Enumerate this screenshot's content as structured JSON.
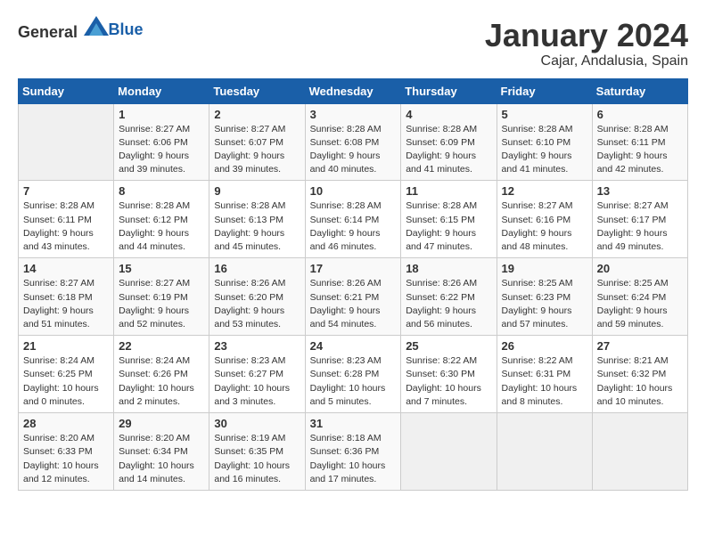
{
  "logo": {
    "general": "General",
    "blue": "Blue"
  },
  "header": {
    "title": "January 2024",
    "subtitle": "Cajar, Andalusia, Spain"
  },
  "columns": [
    "Sunday",
    "Monday",
    "Tuesday",
    "Wednesday",
    "Thursday",
    "Friday",
    "Saturday"
  ],
  "weeks": [
    [
      {
        "day": "",
        "sunrise": "",
        "sunset": "",
        "daylight": ""
      },
      {
        "day": "1",
        "sunrise": "Sunrise: 8:27 AM",
        "sunset": "Sunset: 6:06 PM",
        "daylight": "Daylight: 9 hours and 39 minutes."
      },
      {
        "day": "2",
        "sunrise": "Sunrise: 8:27 AM",
        "sunset": "Sunset: 6:07 PM",
        "daylight": "Daylight: 9 hours and 39 minutes."
      },
      {
        "day": "3",
        "sunrise": "Sunrise: 8:28 AM",
        "sunset": "Sunset: 6:08 PM",
        "daylight": "Daylight: 9 hours and 40 minutes."
      },
      {
        "day": "4",
        "sunrise": "Sunrise: 8:28 AM",
        "sunset": "Sunset: 6:09 PM",
        "daylight": "Daylight: 9 hours and 41 minutes."
      },
      {
        "day": "5",
        "sunrise": "Sunrise: 8:28 AM",
        "sunset": "Sunset: 6:10 PM",
        "daylight": "Daylight: 9 hours and 41 minutes."
      },
      {
        "day": "6",
        "sunrise": "Sunrise: 8:28 AM",
        "sunset": "Sunset: 6:11 PM",
        "daylight": "Daylight: 9 hours and 42 minutes."
      }
    ],
    [
      {
        "day": "7",
        "sunrise": "Sunrise: 8:28 AM",
        "sunset": "Sunset: 6:11 PM",
        "daylight": "Daylight: 9 hours and 43 minutes."
      },
      {
        "day": "8",
        "sunrise": "Sunrise: 8:28 AM",
        "sunset": "Sunset: 6:12 PM",
        "daylight": "Daylight: 9 hours and 44 minutes."
      },
      {
        "day": "9",
        "sunrise": "Sunrise: 8:28 AM",
        "sunset": "Sunset: 6:13 PM",
        "daylight": "Daylight: 9 hours and 45 minutes."
      },
      {
        "day": "10",
        "sunrise": "Sunrise: 8:28 AM",
        "sunset": "Sunset: 6:14 PM",
        "daylight": "Daylight: 9 hours and 46 minutes."
      },
      {
        "day": "11",
        "sunrise": "Sunrise: 8:28 AM",
        "sunset": "Sunset: 6:15 PM",
        "daylight": "Daylight: 9 hours and 47 minutes."
      },
      {
        "day": "12",
        "sunrise": "Sunrise: 8:27 AM",
        "sunset": "Sunset: 6:16 PM",
        "daylight": "Daylight: 9 hours and 48 minutes."
      },
      {
        "day": "13",
        "sunrise": "Sunrise: 8:27 AM",
        "sunset": "Sunset: 6:17 PM",
        "daylight": "Daylight: 9 hours and 49 minutes."
      }
    ],
    [
      {
        "day": "14",
        "sunrise": "Sunrise: 8:27 AM",
        "sunset": "Sunset: 6:18 PM",
        "daylight": "Daylight: 9 hours and 51 minutes."
      },
      {
        "day": "15",
        "sunrise": "Sunrise: 8:27 AM",
        "sunset": "Sunset: 6:19 PM",
        "daylight": "Daylight: 9 hours and 52 minutes."
      },
      {
        "day": "16",
        "sunrise": "Sunrise: 8:26 AM",
        "sunset": "Sunset: 6:20 PM",
        "daylight": "Daylight: 9 hours and 53 minutes."
      },
      {
        "day": "17",
        "sunrise": "Sunrise: 8:26 AM",
        "sunset": "Sunset: 6:21 PM",
        "daylight": "Daylight: 9 hours and 54 minutes."
      },
      {
        "day": "18",
        "sunrise": "Sunrise: 8:26 AM",
        "sunset": "Sunset: 6:22 PM",
        "daylight": "Daylight: 9 hours and 56 minutes."
      },
      {
        "day": "19",
        "sunrise": "Sunrise: 8:25 AM",
        "sunset": "Sunset: 6:23 PM",
        "daylight": "Daylight: 9 hours and 57 minutes."
      },
      {
        "day": "20",
        "sunrise": "Sunrise: 8:25 AM",
        "sunset": "Sunset: 6:24 PM",
        "daylight": "Daylight: 9 hours and 59 minutes."
      }
    ],
    [
      {
        "day": "21",
        "sunrise": "Sunrise: 8:24 AM",
        "sunset": "Sunset: 6:25 PM",
        "daylight": "Daylight: 10 hours and 0 minutes."
      },
      {
        "day": "22",
        "sunrise": "Sunrise: 8:24 AM",
        "sunset": "Sunset: 6:26 PM",
        "daylight": "Daylight: 10 hours and 2 minutes."
      },
      {
        "day": "23",
        "sunrise": "Sunrise: 8:23 AM",
        "sunset": "Sunset: 6:27 PM",
        "daylight": "Daylight: 10 hours and 3 minutes."
      },
      {
        "day": "24",
        "sunrise": "Sunrise: 8:23 AM",
        "sunset": "Sunset: 6:28 PM",
        "daylight": "Daylight: 10 hours and 5 minutes."
      },
      {
        "day": "25",
        "sunrise": "Sunrise: 8:22 AM",
        "sunset": "Sunset: 6:30 PM",
        "daylight": "Daylight: 10 hours and 7 minutes."
      },
      {
        "day": "26",
        "sunrise": "Sunrise: 8:22 AM",
        "sunset": "Sunset: 6:31 PM",
        "daylight": "Daylight: 10 hours and 8 minutes."
      },
      {
        "day": "27",
        "sunrise": "Sunrise: 8:21 AM",
        "sunset": "Sunset: 6:32 PM",
        "daylight": "Daylight: 10 hours and 10 minutes."
      }
    ],
    [
      {
        "day": "28",
        "sunrise": "Sunrise: 8:20 AM",
        "sunset": "Sunset: 6:33 PM",
        "daylight": "Daylight: 10 hours and 12 minutes."
      },
      {
        "day": "29",
        "sunrise": "Sunrise: 8:20 AM",
        "sunset": "Sunset: 6:34 PM",
        "daylight": "Daylight: 10 hours and 14 minutes."
      },
      {
        "day": "30",
        "sunrise": "Sunrise: 8:19 AM",
        "sunset": "Sunset: 6:35 PM",
        "daylight": "Daylight: 10 hours and 16 minutes."
      },
      {
        "day": "31",
        "sunrise": "Sunrise: 8:18 AM",
        "sunset": "Sunset: 6:36 PM",
        "daylight": "Daylight: 10 hours and 17 minutes."
      },
      {
        "day": "",
        "sunrise": "",
        "sunset": "",
        "daylight": ""
      },
      {
        "day": "",
        "sunrise": "",
        "sunset": "",
        "daylight": ""
      },
      {
        "day": "",
        "sunrise": "",
        "sunset": "",
        "daylight": ""
      }
    ]
  ]
}
